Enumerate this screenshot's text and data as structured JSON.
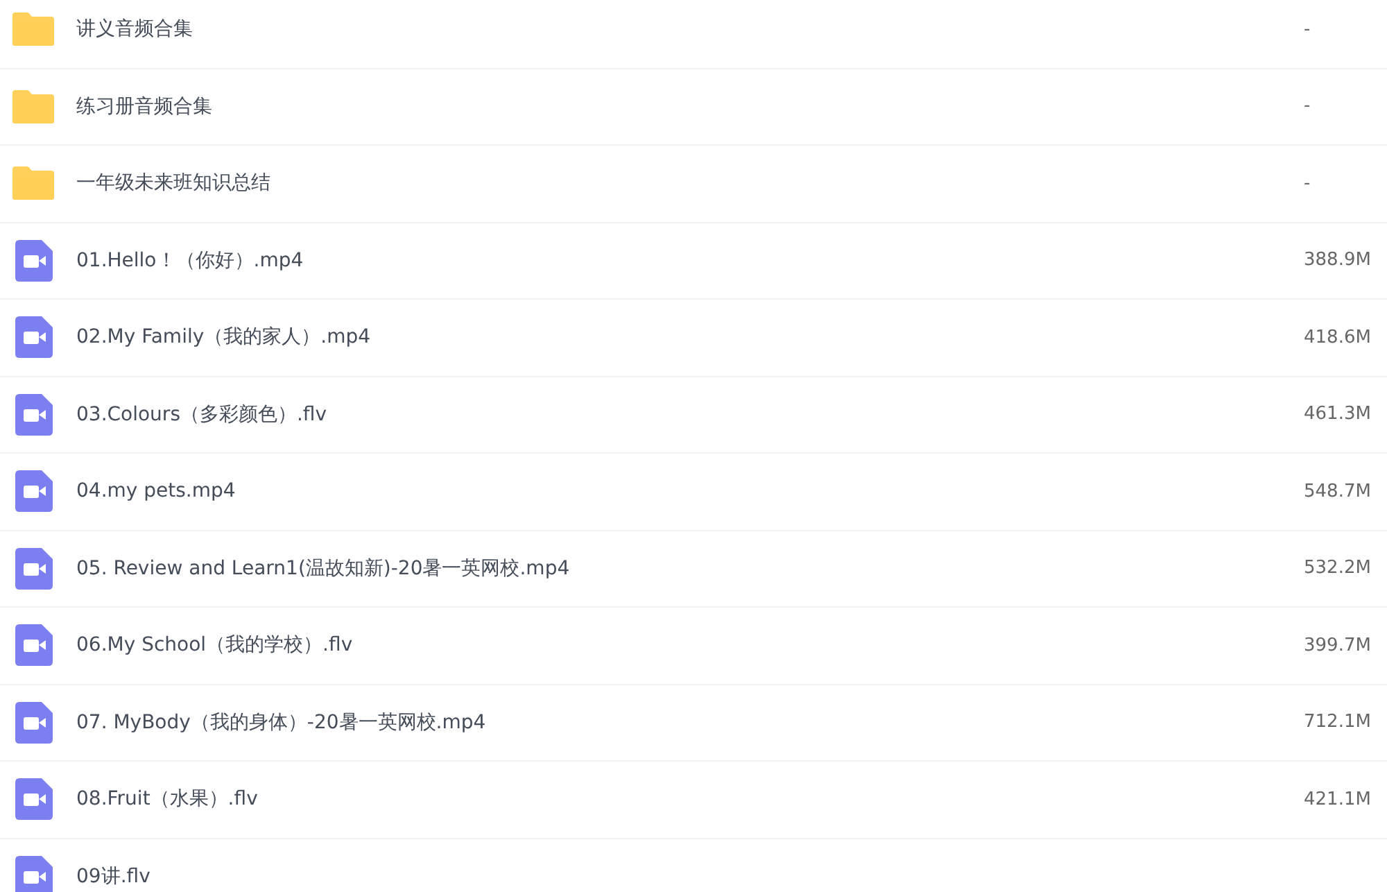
{
  "files": [
    {
      "kind": "folder",
      "name": "讲义音频合集",
      "size": "-"
    },
    {
      "kind": "folder",
      "name": "练习册音频合集",
      "size": "-"
    },
    {
      "kind": "folder",
      "name": "一年级未来班知识总结",
      "size": "-"
    },
    {
      "kind": "video",
      "name": "01.Hello！（你好）.mp4",
      "size": "388.9M"
    },
    {
      "kind": "video",
      "name": "02.My Family（我的家人）.mp4",
      "size": "418.6M"
    },
    {
      "kind": "video",
      "name": "03.Colours（多彩颜色）.flv",
      "size": "461.3M"
    },
    {
      "kind": "video",
      "name": "04.my pets.mp4",
      "size": "548.7M"
    },
    {
      "kind": "video",
      "name": "05. Review and Learn1(温故知新)-20暑一英网校.mp4",
      "size": "532.2M"
    },
    {
      "kind": "video",
      "name": "06.My School（我的学校）.flv",
      "size": "399.7M"
    },
    {
      "kind": "video",
      "name": "07. MyBody（我的身体）-20暑一英网校.mp4",
      "size": "712.1M"
    },
    {
      "kind": "video",
      "name": "08.Fruit（水果）.flv",
      "size": "421.1M"
    },
    {
      "kind": "video",
      "name": "09讲.flv"
    }
  ]
}
